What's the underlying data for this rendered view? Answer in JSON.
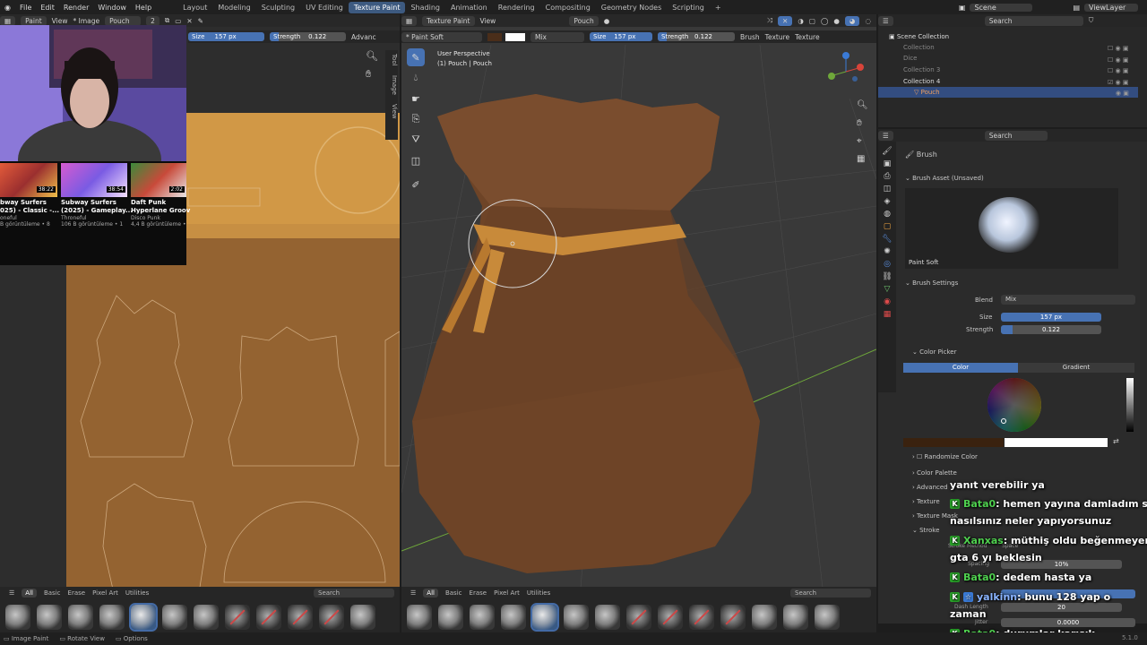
{
  "menu": [
    "File",
    "Edit",
    "Render",
    "Window",
    "Help"
  ],
  "workspaces": [
    "Layout",
    "Modeling",
    "Sculpting",
    "UV Editing",
    "Texture Paint",
    "Shading",
    "Animation",
    "Rendering",
    "Compositing",
    "Geometry Nodes",
    "Scripting"
  ],
  "active_workspace": "Texture Paint",
  "scene": "Scene",
  "view_layer": "ViewLayer",
  "image_editor": {
    "mode": "Paint",
    "view": "View",
    "image": "* Image",
    "image_name": "Pouch",
    "users": "2",
    "size_label": "Size",
    "size_value": "157 px",
    "strength_label": "Strength",
    "strength_value": "0.122",
    "advanced": "Advanc",
    "side_tabs": [
      "Tool",
      "Image",
      "View"
    ]
  },
  "viewport": {
    "mode": "Texture Paint",
    "view": "View",
    "object": "Pouch",
    "brush": "* Paint Soft",
    "blend": "Mix",
    "size_label": "Size",
    "size_value": "157 px",
    "strength_label": "Strength",
    "strength_value": "0.122",
    "brush_menu": "Brush",
    "texture_menu": "Texture",
    "texture2": "Texture",
    "perspective": "User Perspective",
    "object_info": "(1) Pouch | Pouch"
  },
  "asset_tabs": [
    "All",
    "Basic",
    "Erase",
    "Pixel Art",
    "Utilities"
  ],
  "search_placeholder": "Search",
  "outliner": {
    "search": "Search",
    "root": "Scene Collection",
    "items": [
      "Collection",
      "Dice",
      "Collection 3",
      "Collection 4",
      "Pouch"
    ]
  },
  "properties": {
    "search": "Search",
    "title": "Brush",
    "asset_panel": "Brush Asset (Unsaved)",
    "brush_name": "Paint Soft",
    "brush_settings": "Brush Settings",
    "blend_label": "Blend",
    "blend_value": "Mix",
    "size_label": "Size",
    "size_value": "157 px",
    "strength_label": "Strength",
    "strength_value": "0.122",
    "color_picker": "Color Picker",
    "color_tab": "Color",
    "gradient_tab": "Gradient",
    "randomize": "Randomize Color",
    "panels": [
      "Color Palette",
      "Advanced",
      "Texture",
      "Texture Mask",
      "Stroke"
    ],
    "stroke_method": "Stroke Method",
    "stroke_method_value": "Space",
    "spacing_label": "Spacing",
    "spacing_value": "10%",
    "dash_label": "Dash Length",
    "dash_value": "20",
    "jitter_label": "Jitter",
    "jitter_value": "0.0000"
  },
  "videos": [
    {
      "title": "bway Surfers\n025) - Classic -...",
      "channel": "oneful",
      "views": "B görüntüleme • 8",
      "time": "38:22"
    },
    {
      "title": "Subway Surfers\n(2025) - Gameplay...",
      "channel": "Throneful",
      "views": "106 B görüntüleme • 1",
      "time": "38:54"
    },
    {
      "title": "Daft Punk\nHyperlane Groov",
      "channel": "Disco Punk",
      "views": "4,4 B görüntüleme •",
      "time": "2:02"
    }
  ],
  "chat": [
    {
      "user": "",
      "text": "yanıt verebilir ya"
    },
    {
      "user": "Bata0",
      "text": ": hemen yayına damladım siz"
    },
    {
      "user": "",
      "text": "nasılsınız neler yapıyorsunuz"
    },
    {
      "user": "Xanxas",
      "text": ": müthiş oldu beğenmeyen"
    },
    {
      "user": "",
      "text": "gta 6 yı beklesin"
    },
    {
      "user": "Bata0",
      "text": ": dedem hasta ya"
    },
    {
      "user": "yalkinn",
      "text": ": bunu 128 yap o"
    },
    {
      "user": "",
      "text": "zaman"
    },
    {
      "user": "Bata0",
      "text": ": durumlar karışık"
    }
  ],
  "status": {
    "left": "Image Paint",
    "mid": "Rotate View",
    "right": "Options",
    "version": "5.1.0"
  },
  "colors": {
    "accent": "#4772b3",
    "header": "#282828",
    "bg": "#1d1d1d",
    "pouch": "#7a4a2a",
    "band": "#c88a3a",
    "uv_bg": "#c88f3e"
  }
}
